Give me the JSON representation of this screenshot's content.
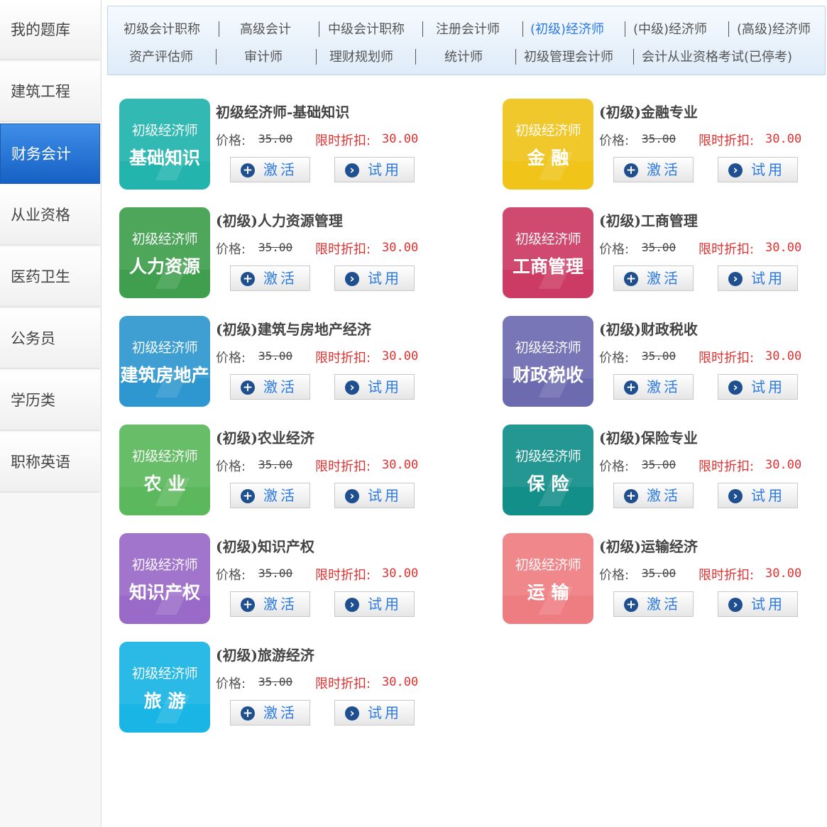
{
  "sidebar": {
    "items": [
      {
        "label": "我的题库"
      },
      {
        "label": "建筑工程"
      },
      {
        "label": "财务会计"
      },
      {
        "label": "从业资格"
      },
      {
        "label": "医药卫生"
      },
      {
        "label": "公务员"
      },
      {
        "label": "学历类"
      },
      {
        "label": "职称英语"
      }
    ],
    "active_index": 2
  },
  "categories": {
    "row1": [
      "初级会计职称",
      "高级会计",
      "中级会计职称",
      "注册会计师",
      "(初级)经济师",
      "(中级)经济师",
      "(高级)经济师"
    ],
    "row2": [
      "资产评估师",
      "审计师",
      "理财规划师",
      "统计师",
      "初级管理会计师",
      "会计从业资格考试(已停考)"
    ],
    "active": "(初级)经济师"
  },
  "labels": {
    "price": "价格:",
    "discount": "限时折扣:",
    "activate": "激活",
    "trial": "试用"
  },
  "products": [
    {
      "title": "初级经济师-基础知识",
      "thumb_top": "初级经济师",
      "thumb_bottom": "基础知识",
      "color": "#22b4ad",
      "price": "35.00",
      "discount": "30.00"
    },
    {
      "title": "(初级)金融专业",
      "thumb_top": "初级经济师",
      "thumb_bottom": "金 融",
      "color": "#f0c419",
      "price": "35.00",
      "discount": "30.00"
    },
    {
      "title": "(初级)人力资源管理",
      "thumb_top": "初级经济师",
      "thumb_bottom": "人力资源",
      "color": "#3f9f4e",
      "price": "35.00",
      "discount": "30.00"
    },
    {
      "title": "(初级)工商管理",
      "thumb_top": "初级经济师",
      "thumb_bottom": "工商管理",
      "color": "#cc3b64",
      "price": "35.00",
      "discount": "30.00"
    },
    {
      "title": "(初级)建筑与房地产经济",
      "thumb_top": "初级经济师",
      "thumb_bottom": "建筑房地产",
      "color": "#2f97d0",
      "price": "35.00",
      "discount": "30.00"
    },
    {
      "title": "(初级)财政税收",
      "thumb_top": "初级经济师",
      "thumb_bottom": "财政税收",
      "color": "#6d6bb0",
      "price": "35.00",
      "discount": "30.00"
    },
    {
      "title": "(初级)农业经济",
      "thumb_top": "初级经济师",
      "thumb_bottom": "农 业",
      "color": "#5cb85c",
      "price": "35.00",
      "discount": "30.00"
    },
    {
      "title": "(初级)保险专业",
      "thumb_top": "初级经济师",
      "thumb_bottom": "保 险",
      "color": "#138f8a",
      "price": "35.00",
      "discount": "30.00"
    },
    {
      "title": "(初级)知识产权",
      "thumb_top": "初级经济师",
      "thumb_bottom": "知识产权",
      "color": "#9a6ac8",
      "price": "35.00",
      "discount": "30.00"
    },
    {
      "title": "(初级)运输经济",
      "thumb_top": "初级经济师",
      "thumb_bottom": "运 输",
      "color": "#ee7d82",
      "price": "35.00",
      "discount": "30.00"
    },
    {
      "title": "(初级)旅游经济",
      "thumb_top": "初级经济师",
      "thumb_bottom": "旅 游",
      "color": "#19b5e4",
      "price": "35.00",
      "discount": "30.00"
    }
  ]
}
